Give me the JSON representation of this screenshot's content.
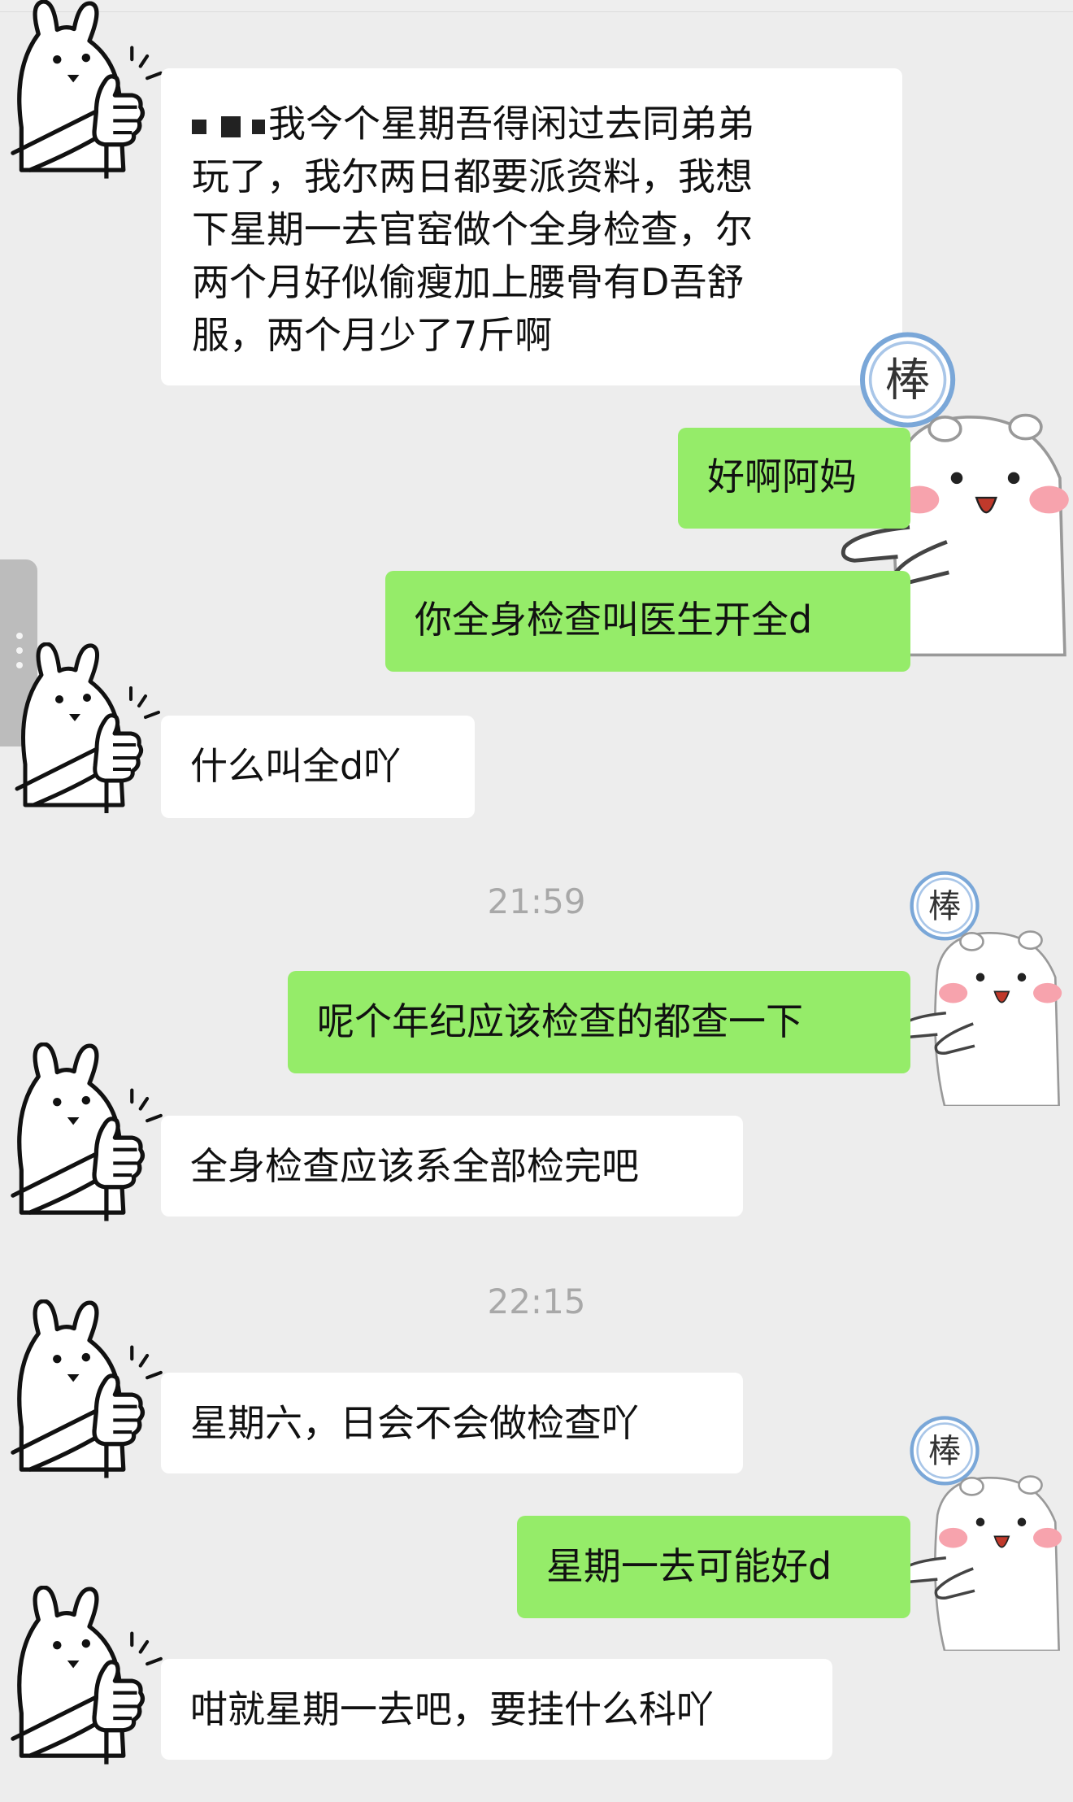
{
  "messages": [
    {
      "side": "in",
      "text": "我今个星期吾得闲过去同弟弟\n玩了，我尔两日都要派资料，我想\n下星期一去官窑做个全身检查，尔\n两个月好似偷瘦加上腰骨有D吾舒\n服，两个月少了7斤啊"
    },
    {
      "side": "out",
      "text": "好啊阿妈"
    },
    {
      "side": "out",
      "text": "你全身检查叫医生开全d"
    },
    {
      "side": "in",
      "text": "什么叫全d吖"
    },
    {
      "side": "out",
      "text": "呢个年纪应该检查的都查一下"
    },
    {
      "side": "in",
      "text": "全身检查应该系全部检完吧"
    },
    {
      "side": "in",
      "text": "星期六，日会不会做检查吖"
    },
    {
      "side": "out",
      "text": "星期一去可能好d"
    },
    {
      "side": "in",
      "text": "咁就星期一去吧，要挂什么科吖"
    }
  ],
  "timestamps": [
    "21:59",
    "22:15"
  ],
  "stickers": {
    "bunny_thumbs_up": "rabbit-thumbs-up-avatar",
    "hamster_bang": {
      "badge": "棒",
      "name": "hamster-bang-sticker"
    }
  },
  "colors": {
    "background": "#ededed",
    "incoming": "#ffffff",
    "outgoing": "#95ec69"
  }
}
